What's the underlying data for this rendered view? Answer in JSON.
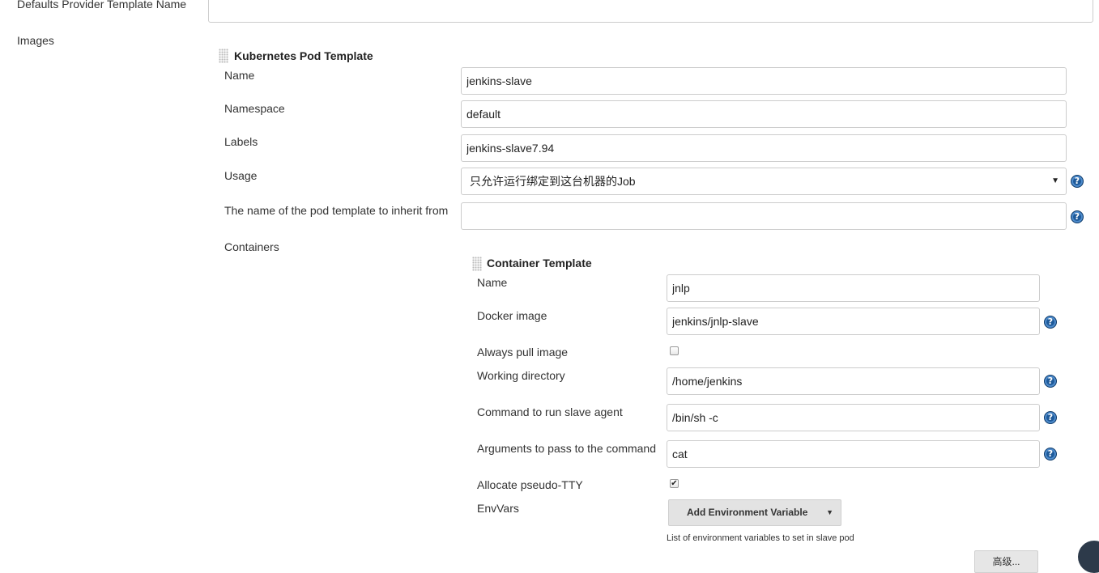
{
  "top": {
    "defaults_provider_label": "Defaults Provider Template Name",
    "defaults_provider_value": "",
    "images_label": "Images"
  },
  "pod_template": {
    "title": "Kubernetes Pod Template",
    "name_label": "Name",
    "name_value": "jenkins-slave",
    "namespace_label": "Namespace",
    "namespace_value": "default",
    "labels_label": "Labels",
    "labels_value": "jenkins-slave7.94",
    "usage_label": "Usage",
    "usage_value": "只允许运行绑定到这台机器的Job",
    "inherit_label": "The name of the pod template to inherit from",
    "inherit_value": "",
    "containers_label": "Containers"
  },
  "container_template": {
    "title": "Container Template",
    "name_label": "Name",
    "name_value": "jnlp",
    "docker_image_label": "Docker image",
    "docker_image_value": "jenkins/jnlp-slave",
    "always_pull_label": "Always pull image",
    "always_pull_checked": false,
    "working_dir_label": "Working directory",
    "working_dir_value": "/home/jenkins",
    "command_label": "Command to run slave agent",
    "command_value": "/bin/sh -c",
    "args_label": "Arguments to pass to the command",
    "args_value": "cat",
    "tty_label": "Allocate pseudo-TTY",
    "tty_checked": true,
    "envvars_label": "EnvVars",
    "add_env_button": "Add Environment Variable",
    "envvars_hint": "List of environment variables to set in slave pod",
    "advanced_button": "高级..."
  },
  "icons": {
    "help": "?",
    "check": "✔",
    "caret": "▼",
    "grip": "drag-handle-icon"
  },
  "colors": {
    "help_icon": "#1e5a9a",
    "border": "#cccccc",
    "button_bg": "#e3e3e3"
  }
}
